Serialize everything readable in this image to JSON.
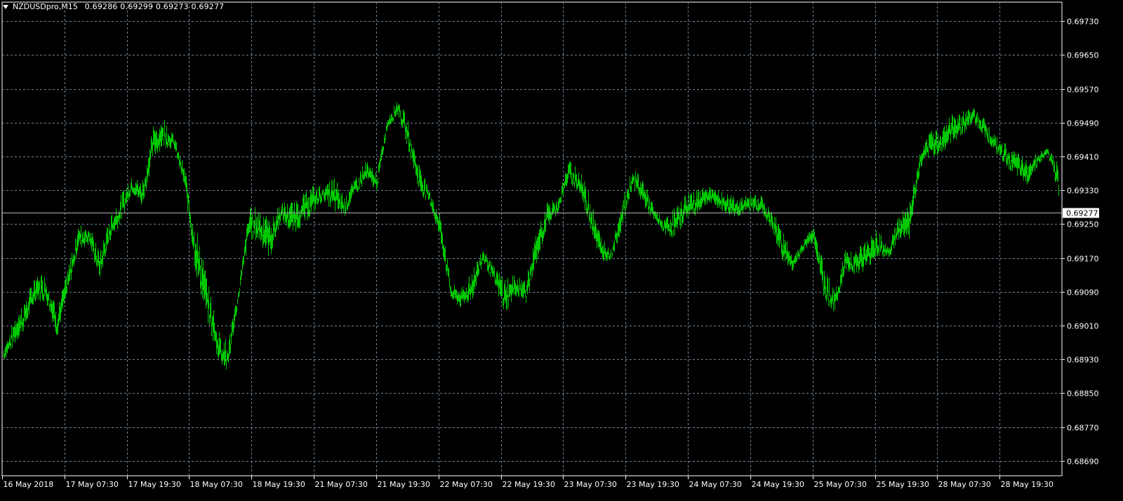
{
  "header": {
    "symbol_timeframe": "NZDUSDpro,M15",
    "ohlc": "0.69286 0.69299 0.69273 0.69277"
  },
  "colors": {
    "background": "#000000",
    "bars": "#00c800",
    "grid": "#6f8499",
    "axis": "#ffffff",
    "price_line": "#b4b4b4"
  },
  "icons": {
    "menu": "triangle-down-icon"
  },
  "chart_data": {
    "type": "bar",
    "style": "OHLC price bars, M15 timeframe",
    "ylim": [
      0.68655,
      0.69775
    ],
    "y_ticks": [
      "0.69730",
      "0.69650",
      "0.69570",
      "0.69490",
      "0.69410",
      "0.69330",
      "0.69250",
      "0.69170",
      "0.69090",
      "0.69010",
      "0.68930",
      "0.68850",
      "0.68770",
      "0.68690"
    ],
    "x_ticks": [
      "16 May 2018",
      "17 May 07:30",
      "17 May 19:30",
      "18 May 07:30",
      "18 May 19:30",
      "21 May 07:30",
      "21 May 19:30",
      "22 May 07:30",
      "22 May 19:30",
      "23 May 07:30",
      "23 May 19:30",
      "24 May 07:30",
      "24 May 19:30",
      "25 May 07:30",
      "25 May 19:30",
      "28 May 07:30",
      "28 May 19:30"
    ],
    "current_price": "0.69277",
    "grid": true,
    "series": [
      {
        "values": [
          [
            0.6892,
            0.6896
          ],
          [
            0.6895,
            0.6903
          ],
          [
            0.6899,
            0.6907
          ],
          [
            0.6906,
            0.6913
          ],
          [
            0.6905,
            0.6913
          ],
          [
            0.6897,
            0.6905
          ],
          [
            0.6907,
            0.6914
          ],
          [
            0.6918,
            0.6925
          ],
          [
            0.6919,
            0.6925
          ],
          [
            0.6911,
            0.6918
          ],
          [
            0.692,
            0.6927
          ],
          [
            0.6924,
            0.6932
          ],
          [
            0.6932,
            0.6936
          ],
          [
            0.6928,
            0.6935
          ],
          [
            0.6939,
            0.6948
          ],
          [
            0.6942,
            0.695
          ],
          [
            0.6942,
            0.6946
          ],
          [
            0.6932,
            0.6938
          ],
          [
            0.6911,
            0.6925
          ],
          [
            0.6901,
            0.6913
          ],
          [
            0.6892,
            0.6901
          ],
          [
            0.6888,
            0.6897
          ],
          [
            0.6906,
            0.6909
          ],
          [
            0.692,
            0.6929
          ],
          [
            0.6919,
            0.6929
          ],
          [
            0.6915,
            0.6926
          ],
          [
            0.6925,
            0.693
          ],
          [
            0.6921,
            0.693
          ],
          [
            0.6923,
            0.6932
          ],
          [
            0.6926,
            0.6934
          ],
          [
            0.693,
            0.6934
          ],
          [
            0.6926,
            0.6936
          ],
          [
            0.6926,
            0.6932
          ],
          [
            0.6931,
            0.6936
          ],
          [
            0.6934,
            0.694
          ],
          [
            0.6932,
            0.6937
          ],
          [
            0.6947,
            0.695
          ],
          [
            0.695,
            0.6955
          ],
          [
            0.6941,
            0.6949
          ],
          [
            0.6931,
            0.6939
          ],
          [
            0.6929,
            0.6933
          ],
          [
            0.6919,
            0.6927
          ],
          [
            0.6906,
            0.6911
          ],
          [
            0.6904,
            0.691
          ],
          [
            0.6906,
            0.6914
          ],
          [
            0.6915,
            0.692
          ],
          [
            0.691,
            0.6915
          ],
          [
            0.6902,
            0.6912
          ],
          [
            0.6907,
            0.6913
          ],
          [
            0.6905,
            0.6912
          ],
          [
            0.6914,
            0.6923
          ],
          [
            0.6923,
            0.693
          ],
          [
            0.6927,
            0.6931
          ],
          [
            0.6934,
            0.694
          ],
          [
            0.6931,
            0.6938
          ],
          [
            0.6923,
            0.6932
          ],
          [
            0.6915,
            0.6922
          ],
          [
            0.6916,
            0.6919
          ],
          [
            0.6922,
            0.6931
          ],
          [
            0.6933,
            0.6938
          ],
          [
            0.6928,
            0.6936
          ],
          [
            0.6925,
            0.6929
          ],
          [
            0.6922,
            0.6926
          ],
          [
            0.692,
            0.6929
          ],
          [
            0.6925,
            0.6932
          ],
          [
            0.6926,
            0.6933
          ],
          [
            0.6929,
            0.6934
          ],
          [
            0.6928,
            0.6933
          ],
          [
            0.6926,
            0.6932
          ],
          [
            0.6926,
            0.6931
          ],
          [
            0.6927,
            0.6932
          ],
          [
            0.6927,
            0.6932
          ],
          [
            0.6923,
            0.6928
          ],
          [
            0.6915,
            0.6925
          ],
          [
            0.6913,
            0.6917
          ],
          [
            0.6918,
            0.6921
          ],
          [
            0.692,
            0.6925
          ],
          [
            0.6905,
            0.6915
          ],
          [
            0.6903,
            0.6909
          ],
          [
            0.6913,
            0.6919
          ],
          [
            0.6912,
            0.6919
          ],
          [
            0.6913,
            0.6921
          ],
          [
            0.6916,
            0.6924
          ],
          [
            0.6916,
            0.692
          ],
          [
            0.692,
            0.6927
          ],
          [
            0.692,
            0.693
          ],
          [
            0.6937,
            0.6942
          ],
          [
            0.694,
            0.6947
          ],
          [
            0.694,
            0.6948
          ],
          [
            0.6943,
            0.6951
          ],
          [
            0.6945,
            0.6952
          ],
          [
            0.6948,
            0.6953
          ],
          [
            0.6945,
            0.695
          ],
          [
            0.6941,
            0.6946
          ],
          [
            0.6938,
            0.6944
          ],
          [
            0.6935,
            0.6942
          ],
          [
            0.6933,
            0.694
          ],
          [
            0.6938,
            0.6942
          ],
          [
            0.6941,
            0.6943
          ],
          [
            0.693,
            0.6939
          ]
        ]
      }
    ]
  }
}
